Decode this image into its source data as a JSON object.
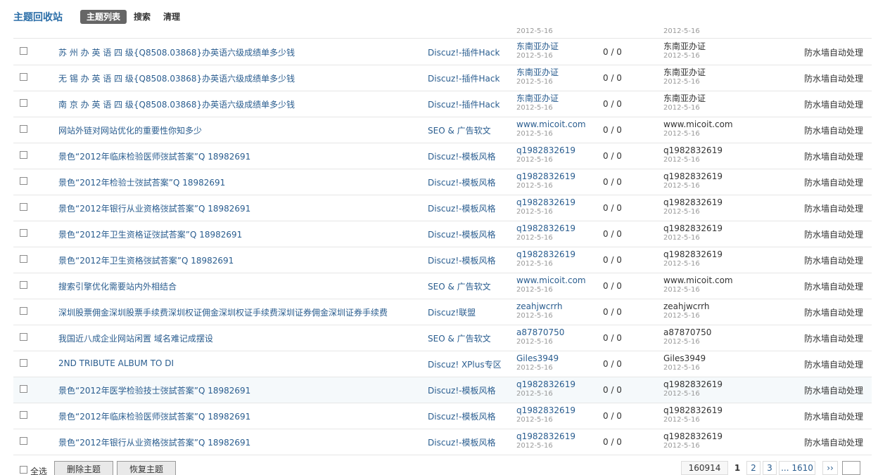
{
  "header": {
    "title": "主题回收站",
    "tabs": [
      "主题列表",
      "搜索",
      "清理"
    ]
  },
  "partial_row": {
    "author_date": "2012-5-16",
    "last_date": "2012-5-16"
  },
  "rows": [
    {
      "subject": "苏 州 办 英 语 四 级{Q8508.03868}办英语六级成绩单多少钱",
      "forum": "Discuz!-插件Hack",
      "author": "东南亚办证",
      "author_date": "2012-5-16",
      "replies": "0 / 0",
      "last": "东南亚办证",
      "last_date": "2012-5-16",
      "reason": "防水墙自动处理"
    },
    {
      "subject": "无 锡 办 英 语 四 级{Q8508.03868}办英语六级成绩单多少钱",
      "forum": "Discuz!-插件Hack",
      "author": "东南亚办证",
      "author_date": "2012-5-16",
      "replies": "0 / 0",
      "last": "东南亚办证",
      "last_date": "2012-5-16",
      "reason": "防水墙自动处理"
    },
    {
      "subject": "南 京 办 英 语 四 级{Q8508.03868}办英语六级成绩单多少钱",
      "forum": "Discuz!-插件Hack",
      "author": "东南亚办证",
      "author_date": "2012-5-16",
      "replies": "0 / 0",
      "last": "东南亚办证",
      "last_date": "2012-5-16",
      "reason": "防水墙自动处理"
    },
    {
      "subject": "网站外链对网站优化的重要性你知多少",
      "forum": "SEO & 广告软文",
      "author": "www.micoit.com",
      "author_date": "2012-5-16",
      "replies": "0 / 0",
      "last": "www.micoit.com",
      "last_date": "2012-5-16",
      "reason": "防水墙自动处理"
    },
    {
      "subject": "景色“2012年临床检验医师弢試荅案”Q 18982691",
      "forum": "Discuz!-模板风格",
      "author": "q1982832619",
      "author_date": "2012-5-16",
      "replies": "0 / 0",
      "last": "q1982832619",
      "last_date": "2012-5-16",
      "reason": "防水墙自动处理"
    },
    {
      "subject": "景色“2012年检验士弢試荅案”Q 18982691",
      "forum": "Discuz!-模板风格",
      "author": "q1982832619",
      "author_date": "2012-5-16",
      "replies": "0 / 0",
      "last": "q1982832619",
      "last_date": "2012-5-16",
      "reason": "防水墙自动处理"
    },
    {
      "subject": "景色“2012年银行从业资格弢試荅案”Q 18982691",
      "forum": "Discuz!-模板风格",
      "author": "q1982832619",
      "author_date": "2012-5-16",
      "replies": "0 / 0",
      "last": "q1982832619",
      "last_date": "2012-5-16",
      "reason": "防水墙自动处理"
    },
    {
      "subject": "景色“2012年卫生资格证弢試荅案”Q 18982691",
      "forum": "Discuz!-模板风格",
      "author": "q1982832619",
      "author_date": "2012-5-16",
      "replies": "0 / 0",
      "last": "q1982832619",
      "last_date": "2012-5-16",
      "reason": "防水墙自动处理"
    },
    {
      "subject": "景色“2012年卫生资格弢試荅案”Q 18982691",
      "forum": "Discuz!-模板风格",
      "author": "q1982832619",
      "author_date": "2012-5-16",
      "replies": "0 / 0",
      "last": "q1982832619",
      "last_date": "2012-5-16",
      "reason": "防水墙自动处理"
    },
    {
      "subject": "搜索引擎优化需要站内外相结合",
      "forum": "SEO & 广告软文",
      "author": "www.micoit.com",
      "author_date": "2012-5-16",
      "replies": "0 / 0",
      "last": "www.micoit.com",
      "last_date": "2012-5-16",
      "reason": "防水墙自动处理"
    },
    {
      "subject": "深圳股票佣金深圳股票手续费深圳权证佣金深圳权证手续费深圳证券佣金深圳证券手续费",
      "forum": "Discuz!联盟",
      "author": "zeahjwcrrh",
      "author_date": "2012-5-16",
      "replies": "0 / 0",
      "last": "zeahjwcrrh",
      "last_date": "2012-5-16",
      "reason": "防水墙自动处理"
    },
    {
      "subject": "我国近八成企业网站闲置 域名难记成摆设",
      "forum": "SEO & 广告软文",
      "author": "a87870750",
      "author_date": "2012-5-16",
      "replies": "0 / 0",
      "last": "a87870750",
      "last_date": "2012-5-16",
      "reason": "防水墙自动处理"
    },
    {
      "subject": "2ND TRIBUTE ALBUM TO DI",
      "forum": "Discuz! XPlus专区",
      "author": "Giles3949",
      "author_date": "2012-5-16",
      "replies": "0 / 0",
      "last": "Giles3949",
      "last_date": "2012-5-16",
      "reason": "防水墙自动处理"
    },
    {
      "subject": "景色“2012年医学检验技士弢試荅案”Q 18982691",
      "forum": "Discuz!-模板风格",
      "author": "q1982832619",
      "author_date": "2012-5-16",
      "replies": "0 / 0",
      "last": "q1982832619",
      "last_date": "2012-5-16",
      "reason": "防水墙自动处理"
    },
    {
      "subject": "景色“2012年临床检验医师弢試荅案”Q 18982691",
      "forum": "Discuz!-模板风格",
      "author": "q1982832619",
      "author_date": "2012-5-16",
      "replies": "0 / 0",
      "last": "q1982832619",
      "last_date": "2012-5-16",
      "reason": "防水墙自动处理"
    },
    {
      "subject": "景色“2012年银行从业资格弢試荅案”Q 18982691",
      "forum": "Discuz!-模板风格",
      "author": "q1982832619",
      "author_date": "2012-5-16",
      "replies": "0 / 0",
      "last": "q1982832619",
      "last_date": "2012-5-16",
      "reason": "防水墙自动处理"
    }
  ],
  "footer": {
    "select_all": "全选",
    "delete_button": "删除主题",
    "restore_button": "恢复主题"
  },
  "pager": {
    "total": "160914",
    "current": "1",
    "page2": "2",
    "page3": "3",
    "last": "... 1610",
    "next": "››"
  }
}
